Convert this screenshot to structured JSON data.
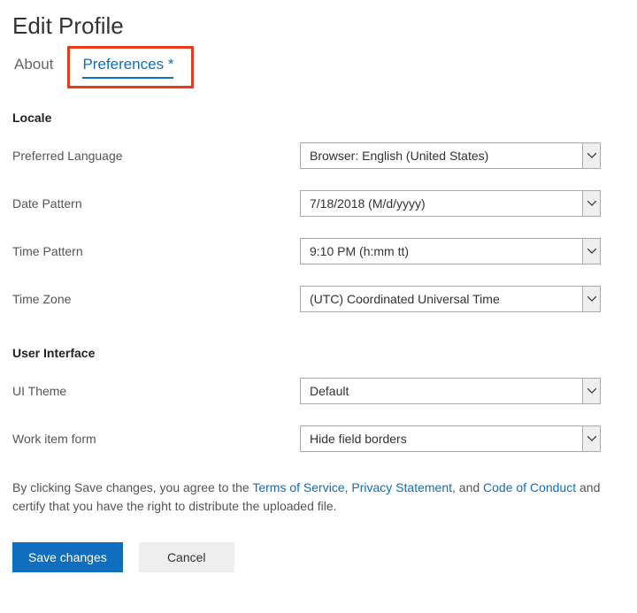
{
  "page_title": "Edit Profile",
  "tabs": {
    "about": "About",
    "preferences": "Preferences *"
  },
  "sections": {
    "locale": {
      "header": "Locale",
      "fields": {
        "language": {
          "label": "Preferred Language",
          "value": "Browser: English (United States)"
        },
        "date_pattern": {
          "label": "Date Pattern",
          "value": "7/18/2018 (M/d/yyyy)"
        },
        "time_pattern": {
          "label": "Time Pattern",
          "value": "9:10 PM (h:mm tt)"
        },
        "time_zone": {
          "label": "Time Zone",
          "value": "(UTC) Coordinated Universal Time"
        }
      }
    },
    "ui": {
      "header": "User Interface",
      "fields": {
        "theme": {
          "label": "UI Theme",
          "value": "Default"
        },
        "work_item_form": {
          "label": "Work item form",
          "value": "Hide field borders"
        }
      }
    }
  },
  "legal": {
    "prefix": "By clicking Save changes, you agree to the ",
    "tos": "Terms of Service",
    "comma1": ", ",
    "privacy": "Privacy Statement",
    "comma2": ", and ",
    "coc": "Code of Conduct",
    "suffix": " and certify that you have the right to distribute the uploaded file."
  },
  "buttons": {
    "save": "Save changes",
    "cancel": "Cancel"
  }
}
